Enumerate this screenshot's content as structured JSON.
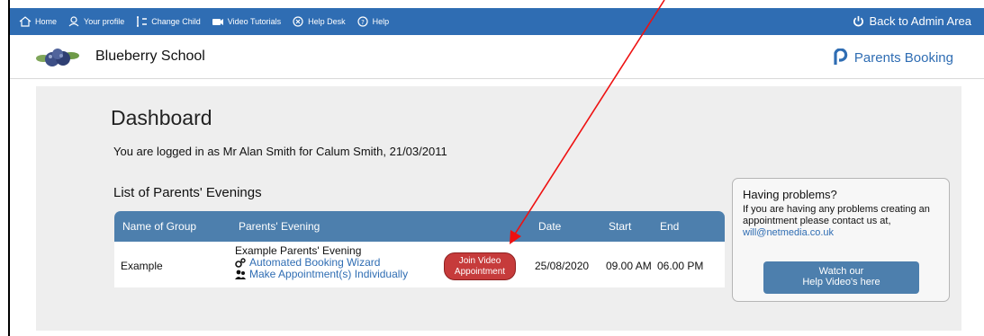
{
  "nav": {
    "items": [
      {
        "label": "Home",
        "icon": "home-icon"
      },
      {
        "label": "Your profile",
        "icon": "user-icon"
      },
      {
        "label": "Change Child",
        "icon": "swap-users-icon"
      },
      {
        "label": "Video Tutorials",
        "icon": "video-camera-icon"
      },
      {
        "label": "Help Desk",
        "icon": "help-desk-icon"
      },
      {
        "label": "Help",
        "icon": "help-icon"
      }
    ],
    "back_label": "Back to Admin Area"
  },
  "header": {
    "school_name": "Blueberry School",
    "brand": "Parents Booking"
  },
  "dashboard": {
    "title": "Dashboard",
    "logged_in": "You are logged in as Mr Alan Smith for Calum Smith, 21/03/2011",
    "list_title": "List of Parents' Evenings"
  },
  "table": {
    "headers": [
      "Name of Group",
      "Parents' Evening",
      "Date",
      "Start",
      "End"
    ],
    "rows": [
      {
        "group": "Example",
        "evening": "Example Parents' Evening",
        "wizard_link": "Automated Booking Wizard",
        "individual_link": "Make Appointment(s) Individually",
        "join_line1": "Join Video",
        "join_line2": "Appointment",
        "date": "25/08/2020",
        "start": "09.00 AM",
        "end": "06.00 PM"
      }
    ]
  },
  "help": {
    "title": "Having problems?",
    "text": "If you are having any problems creating an appointment please contact us at,",
    "email": "will@netmedia.co.uk",
    "button_line1": "Watch our",
    "button_line2": "Help Video's here"
  },
  "colors": {
    "nav_blue": "#2f6db3",
    "table_header": "#4d7fad",
    "join_red": "#c63b3b",
    "annotation_red": "#ee1111"
  }
}
